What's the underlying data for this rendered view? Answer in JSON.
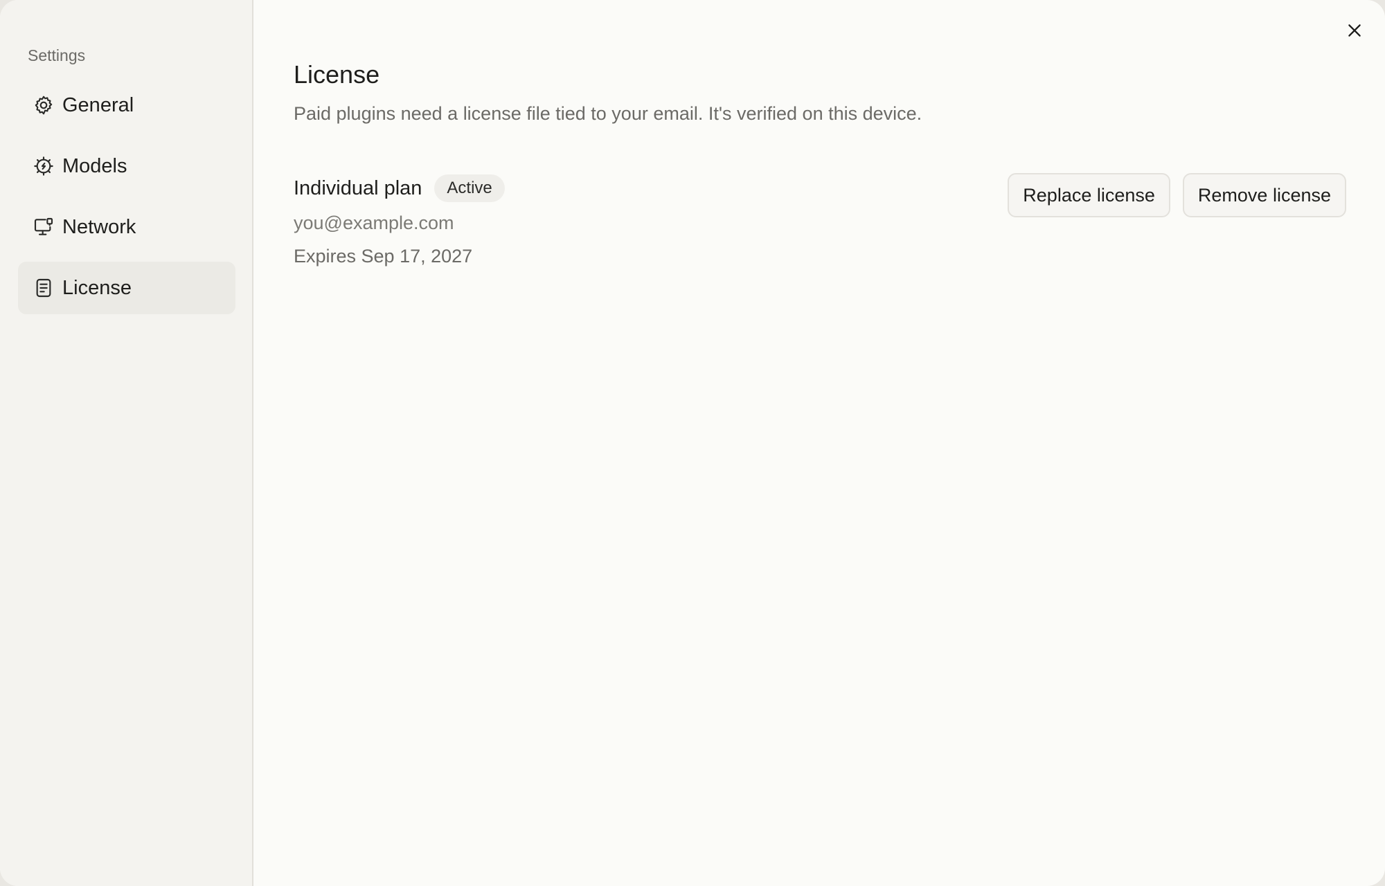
{
  "sidebar": {
    "title": "Settings",
    "items": [
      {
        "label": "General",
        "icon": "gear-icon",
        "active": false
      },
      {
        "label": "Models",
        "icon": "chip-icon",
        "active": false
      },
      {
        "label": "Network",
        "icon": "monitor-network-icon",
        "active": false
      },
      {
        "label": "License",
        "icon": "document-icon",
        "active": true
      }
    ]
  },
  "main": {
    "title": "License",
    "description": "Paid plugins need a license file tied to your email. It's verified on this device.",
    "license": {
      "plan": "Individual plan",
      "status": "Active",
      "email": "you@example.com",
      "expires": "Expires Sep 17, 2027"
    },
    "actions": {
      "replace_label": "Replace license",
      "remove_label": "Remove license"
    }
  },
  "colors": {
    "sidebar_bg": "#f4f3ef",
    "main_bg": "#fbfbf8",
    "active_item_bg": "#ebeae5",
    "text_primary": "#1e1e1c",
    "text_secondary": "#6b6a66"
  }
}
